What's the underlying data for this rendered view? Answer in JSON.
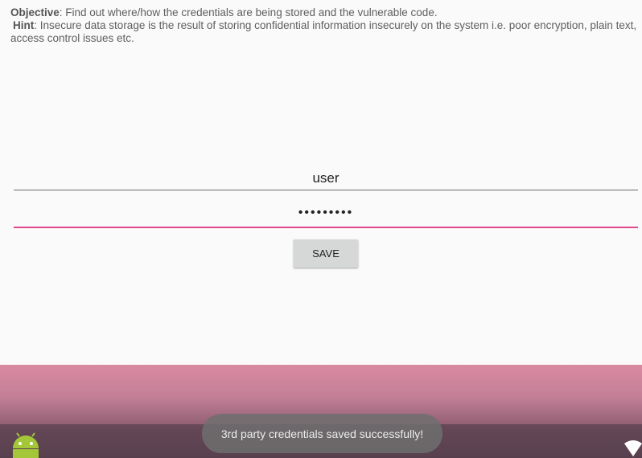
{
  "objective": {
    "objective_label": "Objective",
    "objective_text": ": Find out where/how the credentials are being stored and the vulnerable code.",
    "hint_label": "Hint",
    "hint_text": ": Insecure data storage is the result of storing confidential information insecurely on the system i.e. poor encryption, plain text, access control issues etc."
  },
  "form": {
    "username_value": "user",
    "password_value": "•••••••••",
    "save_label": "SAVE"
  },
  "toast": {
    "message": "3rd party credentials saved successfully!"
  },
  "icons": {
    "launcher": "android-icon",
    "network": "wifi-icon"
  },
  "colors": {
    "accent": "#e0488c",
    "background": "#fafafa"
  }
}
